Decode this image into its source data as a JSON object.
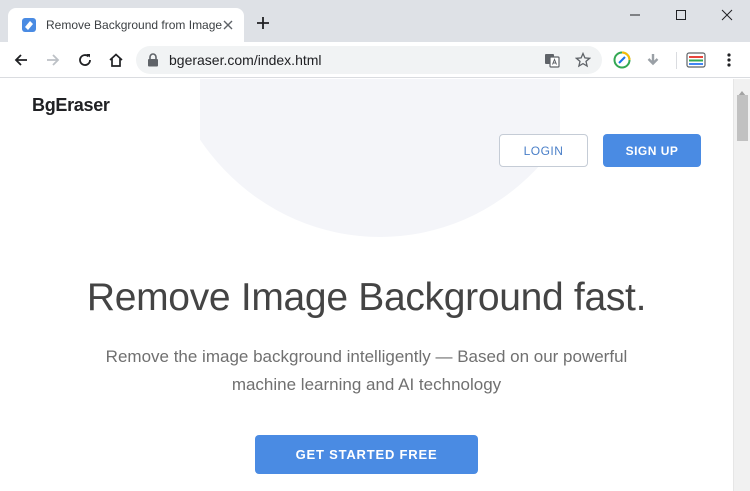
{
  "browser": {
    "tab_title": "Remove Background from Image",
    "address": "bgeraser.com/index.html"
  },
  "page": {
    "logo": "BgEraser",
    "login_label": "LOGIN",
    "signup_label": "SIGN UP",
    "headline": "Remove Image Background fast.",
    "subtitle_line1": "Remove the image background intelligently — Based on our powerful",
    "subtitle_line2": "machine learning and AI technology",
    "cta_label": "GET STARTED FREE"
  },
  "colors": {
    "accent": "#4a8be3",
    "tabstrip": "#dee1e6"
  }
}
